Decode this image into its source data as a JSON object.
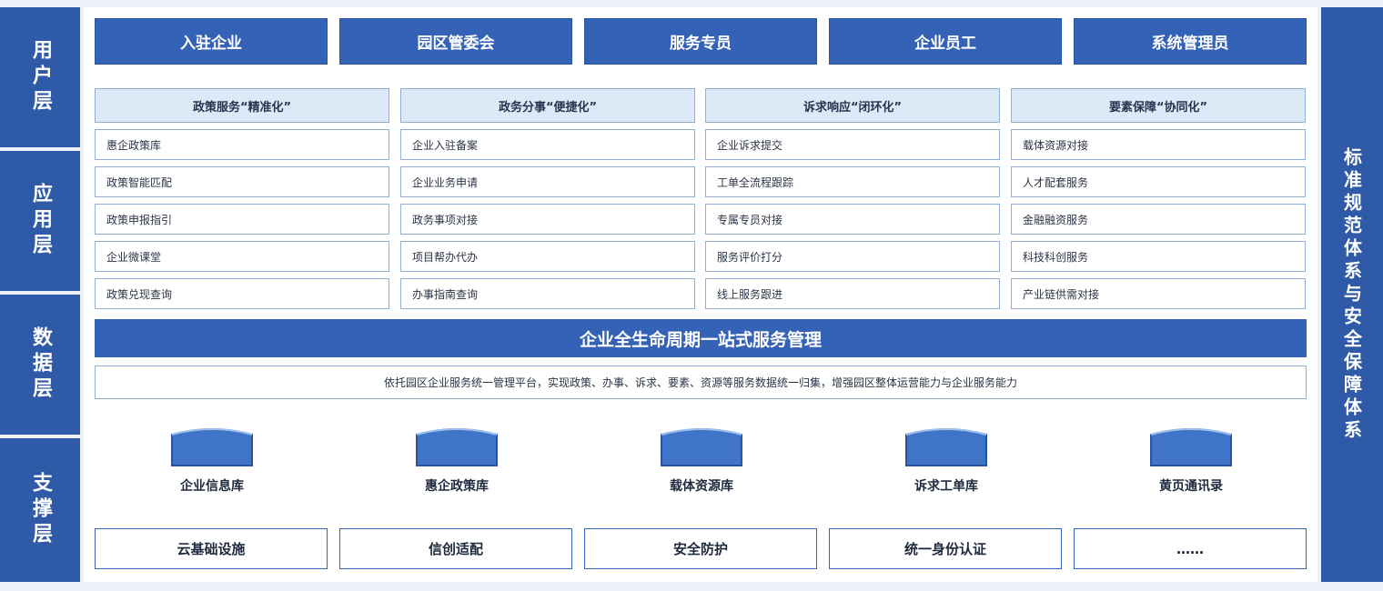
{
  "layers": {
    "user": "用户层",
    "application": "应用层",
    "data": "数据层",
    "support": "支撑层"
  },
  "right_bar": "标准规范体系与安全保障体系",
  "roles": [
    "入驻企业",
    "园区管委会",
    "服务专员",
    "企业员工",
    "系统管理员"
  ],
  "columns": [
    {
      "title": "政策服务“精准化”",
      "items": [
        "惠企政策库",
        "政策智能匹配",
        "政策申报指引",
        "企业微课堂",
        "政策兑现查询"
      ]
    },
    {
      "title": "政务分事“便捷化”",
      "items": [
        "企业入驻备案",
        "企业业务申请",
        "政务事项对接",
        "项目帮办代办",
        "办事指南查询"
      ]
    },
    {
      "title": "诉求响应“闭环化”",
      "items": [
        "企业诉求提交",
        "工单全流程跟踪",
        "专属专员对接",
        "服务评价打分",
        "线上服务跟进"
      ]
    },
    {
      "title": "要素保障“协同化”",
      "items": [
        "载体资源对接",
        "人才配套服务",
        "金融融资服务",
        "科技科创服务",
        "产业链供需对接"
      ]
    }
  ],
  "banner": "企业全生命周期一站式服务管理",
  "description": "依托园区企业服务统一管理平台，实现政策、办事、诉求、要素、资源等服务数据统一归集，增强园区整体运营能力与企业服务能力",
  "databases": [
    "企业信息库",
    "惠企政策库",
    "载体资源库",
    "诉求工单库",
    "黄页通讯录"
  ],
  "infrastructure": [
    "云基础设施",
    "信创适配",
    "安全防护",
    "统一身份认证",
    "……"
  ],
  "colors": {
    "primary": "#3462b6",
    "side_bar": "#2f5aa8",
    "header_fill": "#dce9f6",
    "border": "#8fb0d6"
  }
}
